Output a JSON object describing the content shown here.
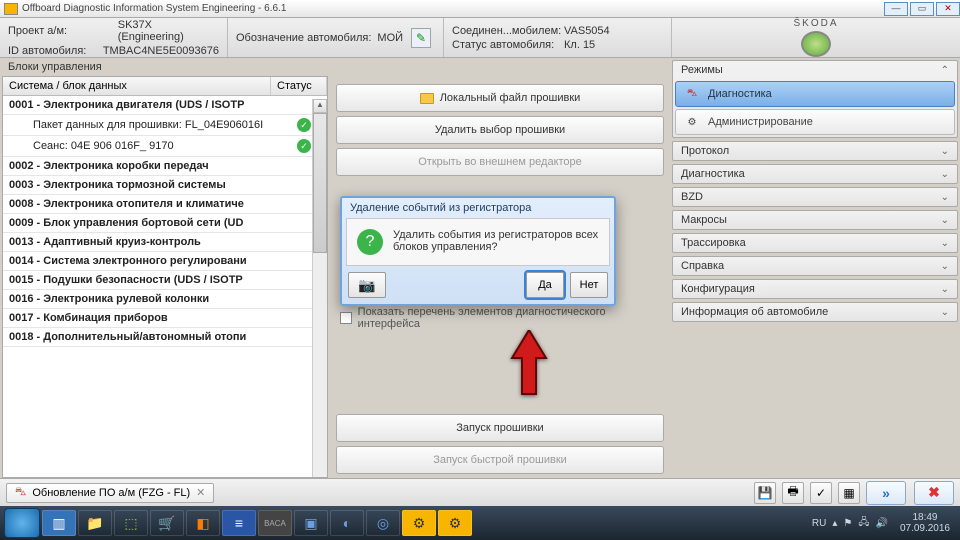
{
  "window": {
    "title": "Offboard Diagnostic Information System Engineering - 6.6.1"
  },
  "info": {
    "project_label": "Проект а/м:",
    "project_value": "SK37X   (Engineering)",
    "vehid_label": "ID автомобиля:",
    "vehid_value": "TMBAC4NE5E0093676",
    "desig_label": "Обозначение автомобиля:",
    "desig_value": "МОЙ",
    "conn_label": "Соединен...мобилем:",
    "conn_value": "VAS5054",
    "status_label": "Статус автомобиля:",
    "status_value": "Кл. 15",
    "brand": "ŠKODA"
  },
  "left": {
    "header": "Блоки управления",
    "col_system": "Система / блок данных",
    "col_status": "Статус",
    "rows": [
      "0001 - Электроника двигателя  (UDS / ISOTP",
      "Пакет данных для прошивки: FL_04E906016I",
      "Сеанс: 04E 906 016F_ 9170",
      "0002 - Электроника коробки передач",
      "0003 - Электроника тормозной системы",
      "0008 - Электроника отопителя и климатиче",
      "0009 - Блок управления бортовой сети  (UD",
      "0013 - Адаптивный круиз-контроль",
      "0014 - Система электронного регулировани",
      "0015 - Подушки безопасности  (UDS / ISOTP",
      "0016 - Электроника рулевой колонки",
      "0017 - Комбинация приборов",
      "0018 - Дополнительный/автономный отопи"
    ]
  },
  "mid": {
    "b_local": "Локальный файл прошивки",
    "b_clear": "Удалить выбор прошивки",
    "b_external": "Открыть во внешнем редакторе",
    "chk_label": "Показать перечень элементов диагностического интерфейса",
    "b_launch": "Запуск прошивки",
    "b_quick": "Запуск быстрой прошивки"
  },
  "right": {
    "modes": "Режимы",
    "diag": "Диагностика",
    "admin": "Администрирование",
    "protocol": "Протокол",
    "diagnostics": "Диагностика",
    "bzd": "BZD",
    "macros": "Макросы",
    "trace": "Трассировка",
    "help": "Справка",
    "config": "Конфигурация",
    "vehinfo": "Информация об автомобиле"
  },
  "dialog": {
    "title": "Удаление событий из регистратора",
    "text": "Удалить события из регистраторов всех блоков управления?",
    "yes": "Да",
    "no": "Нет"
  },
  "bottombar": {
    "tab": "Обновление ПО а/м (FZG - FL)"
  },
  "taskbar": {
    "lang": "RU",
    "time": "18:49",
    "date": "07.09.2016"
  }
}
